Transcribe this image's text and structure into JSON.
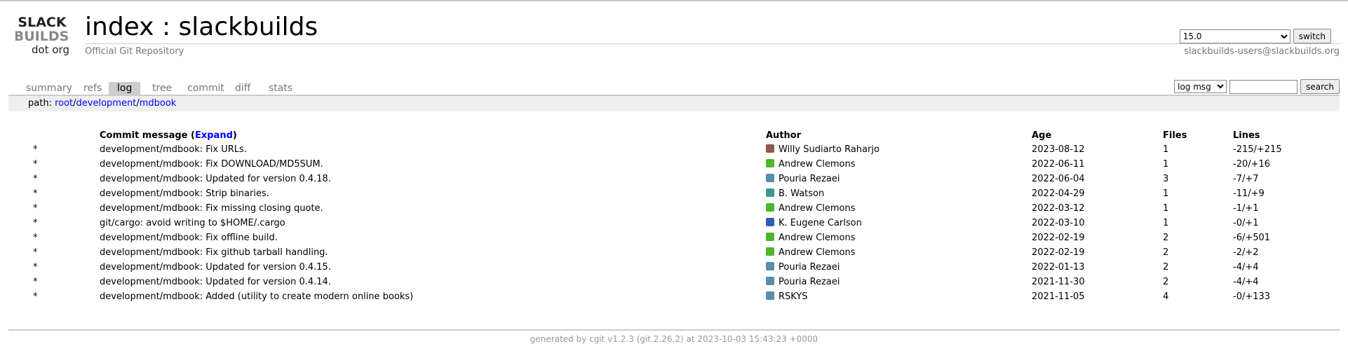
{
  "logo": {
    "line1": "SLACK",
    "line2": "BUILDS",
    "line3": "dot org"
  },
  "header": {
    "repo_index": "index",
    "separator": " : ",
    "repo_name": "slackbuilds",
    "subtitle": "Official Git Repository",
    "branch_selected": "15.0",
    "switch_label": "switch",
    "email": "slackbuilds-users@slackbuilds.org"
  },
  "tabs": [
    {
      "label": "summary",
      "active": false
    },
    {
      "label": "refs",
      "active": false
    },
    {
      "label": "log",
      "active": true
    },
    {
      "label": "tree",
      "active": false
    },
    {
      "label": "commit",
      "active": false
    },
    {
      "label": "diff",
      "active": false
    },
    {
      "label": "stats",
      "active": false
    }
  ],
  "search": {
    "mode": "log msg",
    "search_label": "search",
    "query": ""
  },
  "path": {
    "label": "path: ",
    "root": "root",
    "sep": "/",
    "seg1": "development",
    "seg2": "mdbook"
  },
  "log": {
    "headers": {
      "message": "Commit message (",
      "expand": "Expand",
      "message_end": ")",
      "author": "Author",
      "age": "Age",
      "files": "Files",
      "lines": "Lines"
    },
    "rows": [
      {
        "star": "*",
        "message": "development/mdbook: Fix URLs.",
        "author": "Willy Sudiarto Raharjo",
        "avatar_color": "#8a5c4a",
        "age": "2023-08-12",
        "files": "1",
        "lines": "-215/+215"
      },
      {
        "star": "*",
        "message": "development/mdbook: Fix DOWNLOAD/MD5SUM.",
        "author": "Andrew Clemons",
        "avatar_color": "#4fb52a",
        "age": "2022-06-11",
        "files": "1",
        "lines": "-20/+16"
      },
      {
        "star": "*",
        "message": "development/mdbook: Updated for version 0.4.18.",
        "author": "Pouria Rezaei",
        "avatar_color": "#5a8ab0",
        "age": "2022-06-04",
        "files": "3",
        "lines": "-7/+7"
      },
      {
        "star": "*",
        "message": "development/mdbook: Strip binaries.",
        "author": "B. Watson",
        "avatar_color": "#3a9a8a",
        "age": "2022-04-29",
        "files": "1",
        "lines": "-11/+9"
      },
      {
        "star": "*",
        "message": "development/mdbook: Fix missing closing quote.",
        "author": "Andrew Clemons",
        "avatar_color": "#4fb52a",
        "age": "2022-03-12",
        "files": "1",
        "lines": "-1/+1"
      },
      {
        "star": "*",
        "message": "git/cargo: avoid writing to $HOME/.cargo",
        "author": "K. Eugene Carlson",
        "avatar_color": "#2d5fb5",
        "age": "2022-03-10",
        "files": "1",
        "lines": "-0/+1"
      },
      {
        "star": "*",
        "message": "development/mdbook: Fix offline build.",
        "author": "Andrew Clemons",
        "avatar_color": "#4fb52a",
        "age": "2022-02-19",
        "files": "2",
        "lines": "-6/+501"
      },
      {
        "star": "*",
        "message": "development/mdbook: Fix github tarball handling.",
        "author": "Andrew Clemons",
        "avatar_color": "#4fb52a",
        "age": "2022-02-19",
        "files": "2",
        "lines": "-2/+2"
      },
      {
        "star": "*",
        "message": "development/mdbook: Updated for version 0.4.15.",
        "author": "Pouria Rezaei",
        "avatar_color": "#5a8ab0",
        "age": "2022-01-13",
        "files": "2",
        "lines": "-4/+4"
      },
      {
        "star": "*",
        "message": "development/mdbook: Updated for version 0.4.14.",
        "author": "Pouria Rezaei",
        "avatar_color": "#5a8ab0",
        "age": "2021-11-30",
        "files": "2",
        "lines": "-4/+4"
      },
      {
        "star": "*",
        "message": "development/mdbook: Added (utility to create modern online books)",
        "author": "RSKYS",
        "avatar_color": "#5a8ab0",
        "age": "2021-11-05",
        "files": "4",
        "lines": "-0/+133"
      }
    ]
  },
  "footer": {
    "text": "generated by cgit v1.2.3 (git 2.26.2) at 2023-10-03 15:43:23 +0000"
  }
}
